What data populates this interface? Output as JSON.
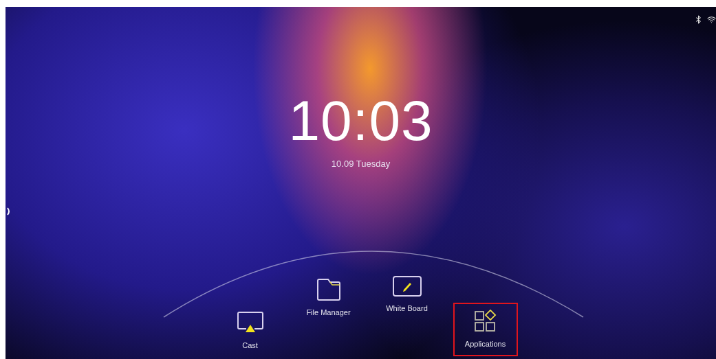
{
  "clock": {
    "time": "10:03",
    "date": "10.09 Tuesday"
  },
  "dock": [
    {
      "kind": "cast",
      "label": "Cast",
      "selected": false
    },
    {
      "kind": "folder",
      "label": "File Manager",
      "selected": false
    },
    {
      "kind": "whiteboard",
      "label": "White Board",
      "selected": false
    },
    {
      "kind": "apps",
      "label": "Applications",
      "selected": true
    }
  ]
}
